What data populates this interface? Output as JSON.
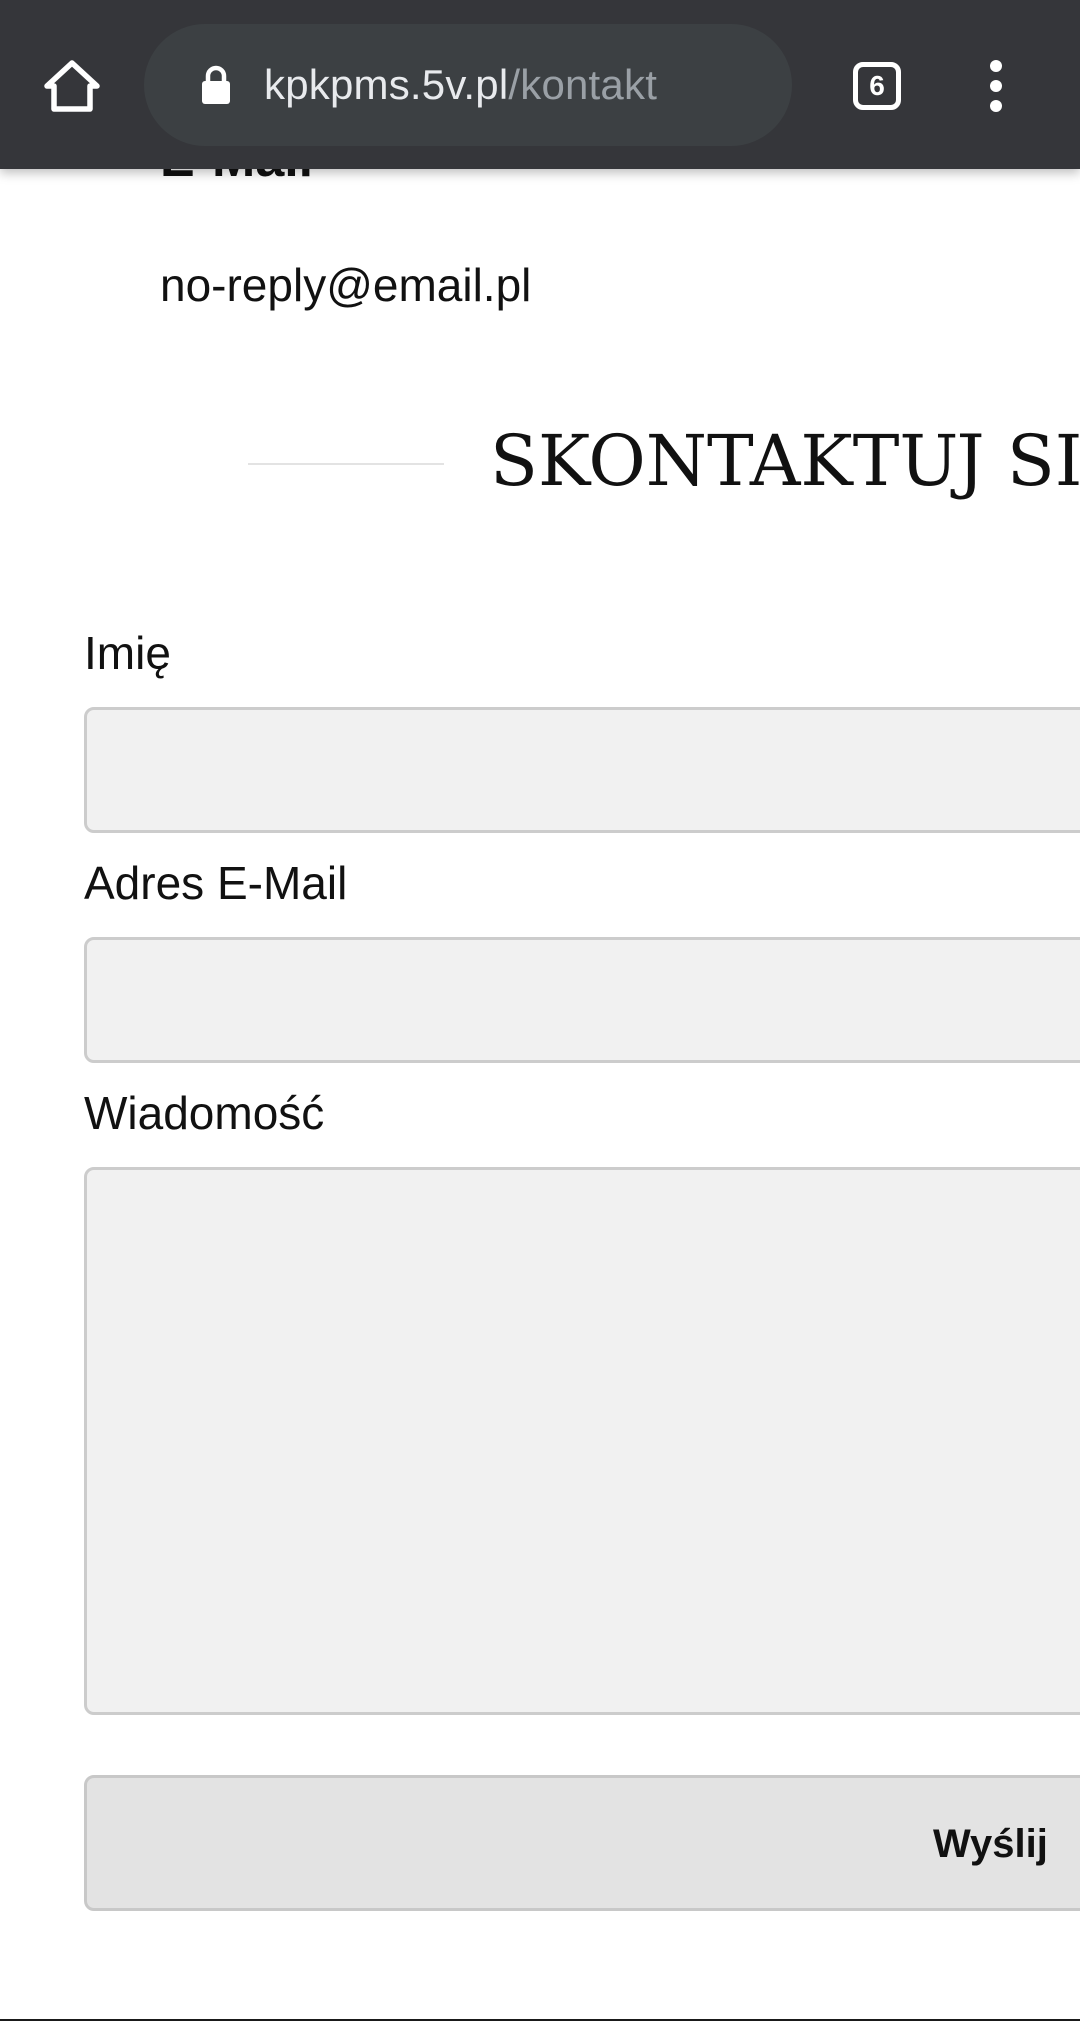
{
  "browser": {
    "url_host": "kpkpms.5v.pl",
    "url_path": "/kontakt",
    "tab_count": "6",
    "colors": {
      "toolbar": "#35363a",
      "omnibox": "#3c4043",
      "url_host": "#e8eaed",
      "url_path": "#9aa0a6"
    },
    "icons": [
      "home-icon",
      "lock-icon",
      "tab-switcher-icon",
      "more-vert-icon"
    ]
  },
  "contact_info": {
    "email_heading": "E-Mail",
    "email_value": "no-reply@email.pl"
  },
  "form": {
    "title": "SKONTAKTUJ SIĘ",
    "name_label": "Imię",
    "name_value": "",
    "email_label": "Adres E-Mail",
    "email_value": "",
    "message_label": "Wiadomość",
    "message_value": "",
    "submit_label": "Wyślij",
    "colors": {
      "field_background": "#f1f1f1",
      "field_border": "#cccccc",
      "button_background": "#e3e3e3"
    }
  }
}
